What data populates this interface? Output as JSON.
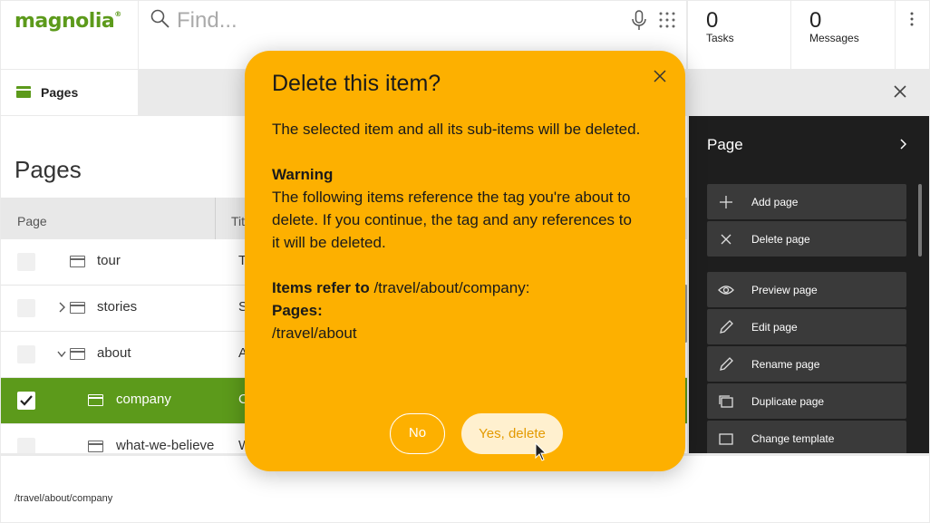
{
  "app": {
    "logo_text": "magnolia",
    "logo_mark": "®"
  },
  "header": {
    "search_placeholder": "Find...",
    "tasks": {
      "count": "0",
      "label": "Tasks"
    },
    "messages": {
      "count": "0",
      "label": "Messages"
    }
  },
  "tab": {
    "label": "Pages"
  },
  "main": {
    "title": "Pages",
    "columns": [
      "Page",
      "Title"
    ],
    "rows": [
      {
        "name": "tour",
        "title": "T",
        "level": 1,
        "expander": "",
        "selected": false
      },
      {
        "name": "stories",
        "title": "S",
        "level": 1,
        "expander": "collapsed",
        "selected": false
      },
      {
        "name": "about",
        "title": "A",
        "level": 1,
        "expander": "expanded",
        "selected": false
      },
      {
        "name": "company",
        "title": "C",
        "level": 2,
        "expander": "",
        "selected": true
      },
      {
        "name": "what-we-believe",
        "title": "W",
        "level": 2,
        "expander": "",
        "selected": false
      }
    ]
  },
  "statusbar": {
    "path": "/travel/about/company"
  },
  "action_panel": {
    "title": "Page",
    "items": [
      {
        "label": "Add page",
        "icon": "plus-icon"
      },
      {
        "label": "Delete page",
        "icon": "x-icon"
      },
      {
        "label": "Preview page",
        "icon": "eye-icon"
      },
      {
        "label": "Edit page",
        "icon": "pencil-icon"
      },
      {
        "label": "Rename page",
        "icon": "pencil-icon"
      },
      {
        "label": "Duplicate page",
        "icon": "duplicate-icon"
      },
      {
        "label": "Change template",
        "icon": "template-icon"
      }
    ]
  },
  "dialog": {
    "title": "Delete this item?",
    "message": "The selected item and all its sub-items will be deleted.",
    "warning_heading": "Warning",
    "warning_line1": "The following items reference the tag you're about to",
    "warning_line2": "delete. If you continue, the tag and any references to",
    "warning_line3": "it will be deleted.",
    "refer_label": "Items refer to",
    "refer_path": "/travel/about/company:",
    "pages_label": "Pages:",
    "pages_path": "/travel/about",
    "no_label": "No",
    "yes_label": "Yes, delete"
  },
  "colors": {
    "brand": "#5c9a1b",
    "dialog_bg": "#fdb000",
    "panel_bg": "#1e1e1e"
  }
}
